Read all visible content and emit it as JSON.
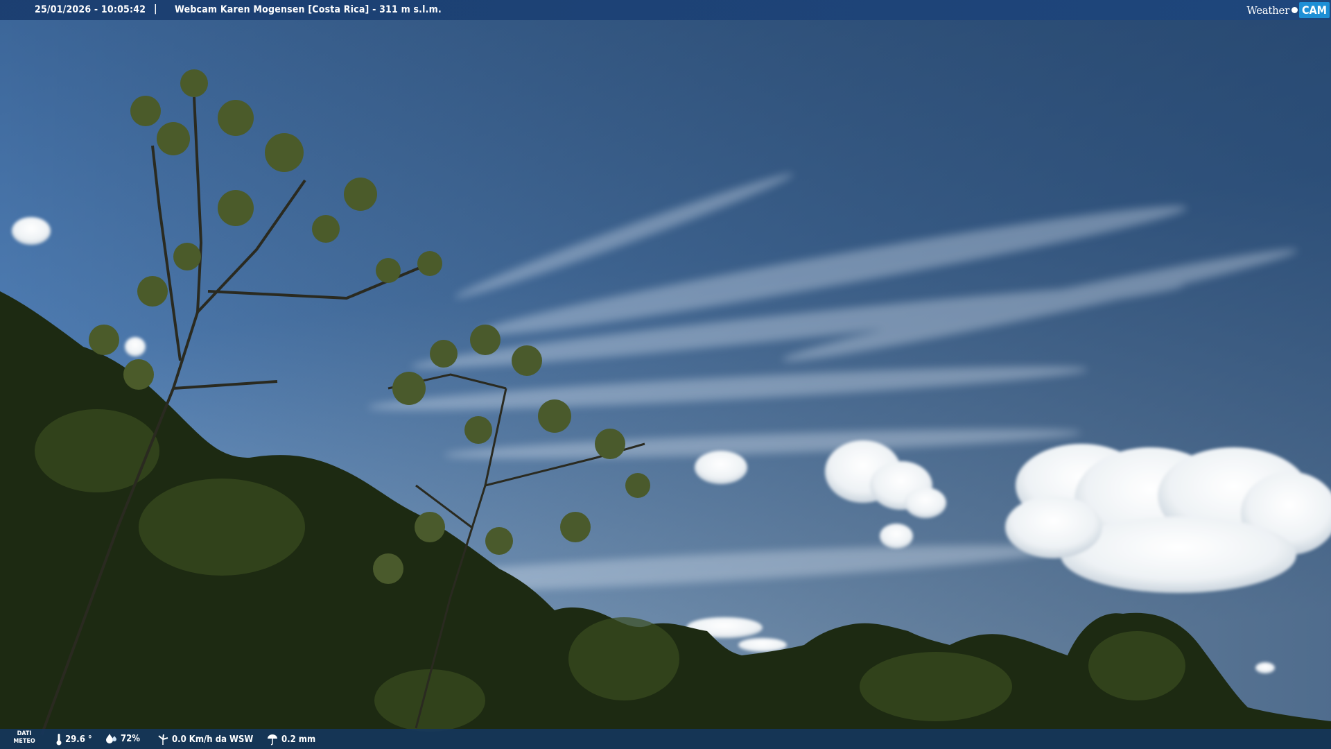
{
  "overlay_top": {
    "timestamp": "25/01/2026 - 10:05:42",
    "separator": "|",
    "title": "Webcam Karen Mogensen [Costa Rica] - 311 m s.l.m."
  },
  "logo": {
    "weather": "Weather",
    "cam": "CAM"
  },
  "overlay_bottom": {
    "dati_label_1": "DATI",
    "dati_label_2": "METEO",
    "temperature": "29.6 °",
    "humidity": "72%",
    "wind": "0.0 Km/h da WSW",
    "rain": "0.2 mm"
  },
  "icons": {
    "temperature": "thermometer-icon",
    "humidity": "humidity-drop-icon",
    "wind": "wind-icon",
    "rain": "rain-icon"
  },
  "colors": {
    "sky_top": "#2c4f7e",
    "sky_bottom": "#8fb3d9",
    "bar": "#1d4a80",
    "logo_accent": "#1e8fd6",
    "foliage_dark": "#1d2a12"
  }
}
